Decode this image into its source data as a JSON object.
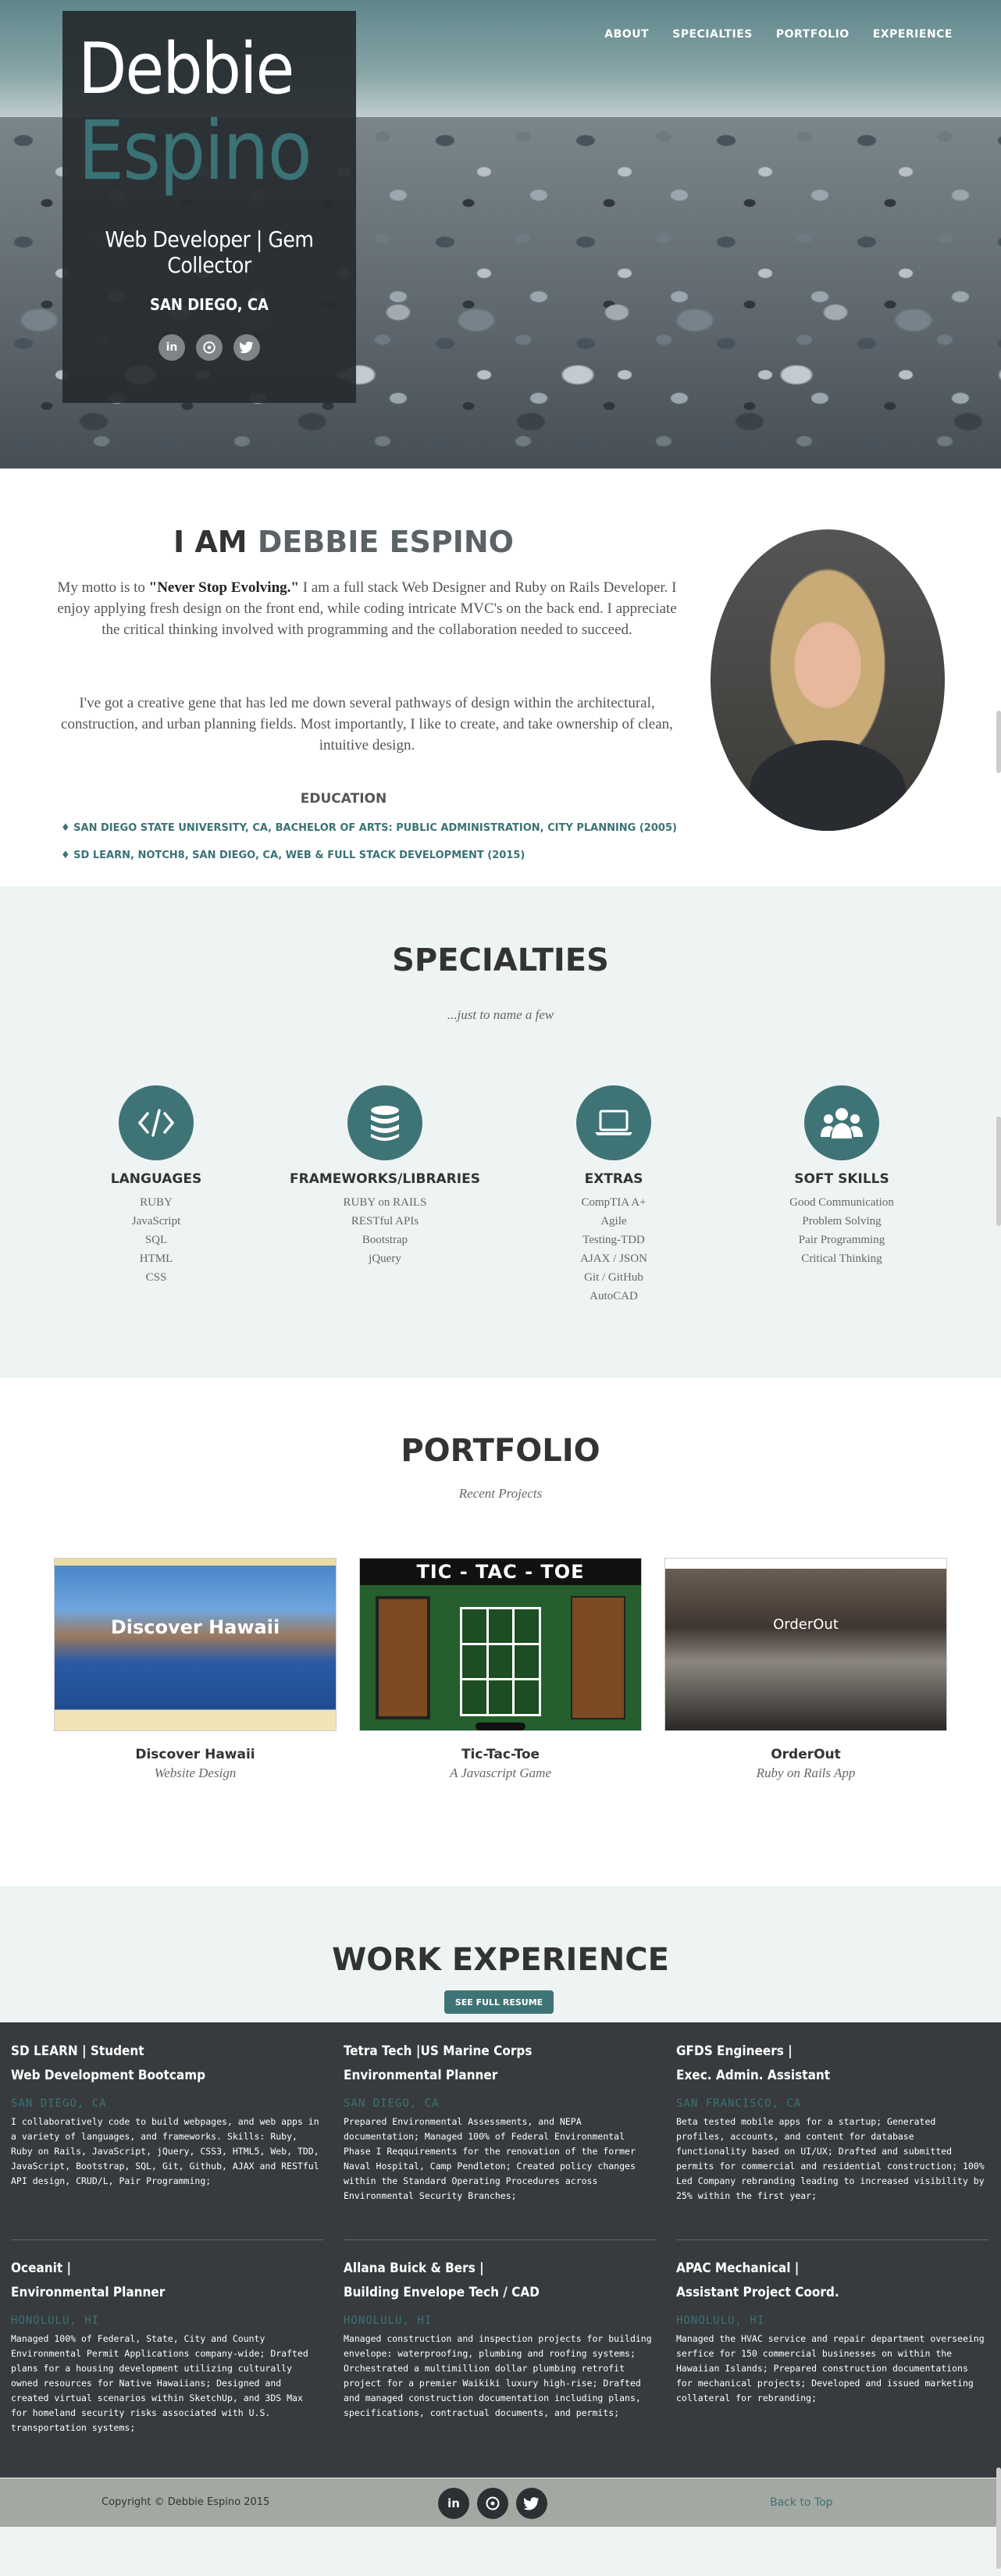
{
  "nav": {
    "items": [
      "ABOUT",
      "SPECIALTIES",
      "PORTFOLIO",
      "EXPERIENCE"
    ]
  },
  "hero": {
    "first_name": "Debbie",
    "last_name": "Espino",
    "tagline": "Web Developer | Gem Collector",
    "location": "SAN DIEGO, CA",
    "social": [
      "in",
      "gh",
      "tw"
    ]
  },
  "about": {
    "heading_prefix": "I AM ",
    "heading_name": "DEBBIE ESPINO",
    "p1_before": "My motto is to ",
    "p1_bold": "\"Never Stop Evolving.\"",
    "p1_after": " I am a full stack Web Designer and Ruby on Rails Developer. I enjoy applying fresh design on the front end, while coding intricate MVC's on the back end. I appreciate the critical thinking involved with programming and the collaboration needed to succeed.",
    "p2": "I've got a creative gene that has led me down several pathways of design within the architectural, construction, and urban planning fields. Most importantly, I like to create, and take ownership of clean, intuitive design.",
    "education_title": "EDUCATION",
    "education": [
      "♦ SAN DIEGO STATE UNIVERSITY, CA, BACHELOR OF ARTS: PUBLIC ADMINISTRATION, CITY PLANNING (2005)",
      "♦ SD LEARN, NOTCH8, SAN DIEGO, CA, WEB & FULL STACK DEVELOPMENT (2015)"
    ]
  },
  "specialties": {
    "title": "SPECIALTIES",
    "subtitle": "...just to name a few",
    "columns": [
      {
        "icon": "code-icon",
        "title": "LANGUAGES",
        "items": [
          "RUBY",
          "JavaScript",
          "SQL",
          "HTML",
          "CSS"
        ]
      },
      {
        "icon": "database-icon",
        "title": "FRAMEWORKS/LIBRARIES",
        "items": [
          "RUBY on RAILS",
          "RESTful APIs",
          "Bootstrap",
          "jQuery"
        ]
      },
      {
        "icon": "laptop-icon",
        "title": "EXTRAS",
        "items": [
          "CompTIA A+",
          "Agile",
          "Testing-TDD",
          "AJAX / JSON",
          "Git / GitHub",
          "AutoCAD"
        ]
      },
      {
        "icon": "users-icon",
        "title": "SOFT SKILLS",
        "items": [
          "Good Communication",
          "Problem Solving",
          "Pair Programming",
          "Critical Thinking"
        ]
      }
    ]
  },
  "portfolio": {
    "title": "PORTFOLIO",
    "subtitle": "Recent Projects",
    "projects": [
      {
        "name": "Discover Hawaii",
        "caption": "Website Design",
        "thumb_text": "Discover Hawaii"
      },
      {
        "name": "Tic-Tac-Toe",
        "caption": "A Javascript Game",
        "thumb_text": "TIC - TAC - TOE"
      },
      {
        "name": "OrderOut",
        "caption": "Ruby on Rails App",
        "thumb_text": "OrderOut"
      }
    ]
  },
  "experience": {
    "title": "WORK EXPERIENCE",
    "resume_button": "SEE FULL RESUME",
    "jobs": [
      {
        "company": "SD LEARN | Student",
        "role": "Web Development Bootcamp",
        "location": "SAN DIEGO, CA",
        "desc": "I collaboratively code to build webpages, and web apps in a variety of languages, and frameworks. Skills: Ruby, Ruby on Rails, JavaScript, jQuery, CSS3, HTML5, Web, TDD, JavaScript, Bootstrap, SQL, Git, Github, AJAX and RESTful API design, CRUD/L, Pair Programming;"
      },
      {
        "company": "Tetra Tech |US Marine Corps",
        "role": "Environmental Planner",
        "location": "SAN DIEGO, CA",
        "desc": "Prepared Environmental Assessments, and NEPA documentation; Managed 100% of Federal Environmental Phase I Reqquirements for the renovation of the former Naval Hospital, Camp Pendleton; Created policy changes within the Standard Operating Procedures across Environmental Security Branches;"
      },
      {
        "company": "GFDS Engineers |",
        "role": "Exec. Admin. Assistant",
        "location": "SAN FRANCISCO, CA",
        "desc": "Beta tested mobile apps for a startup; Generated profiles, accounts, and content for database functionality based on UI/UX; Drafted and submitted permits for commercial and residential construction; 100% Led Company rebranding leading to increased visibility by 25% within the first year;"
      },
      {
        "company": "Oceanit |",
        "role": "Environmental Planner",
        "location": "HONOLULU, HI",
        "desc": "Managed 100% of Federal, State, City and County Environmental Permit Applications company-wide; Drafted plans for a housing development utilizing culturally owned resources for Native Hawaiians; Designed and created virtual scenarios within SketchUp, and 3DS Max for homeland security risks associated with U.S. transportation systems;"
      },
      {
        "company": "Allana Buick & Bers |",
        "role": "Building Envelope Tech / CAD",
        "location": "HONOLULU, HI",
        "desc": "Managed construction and inspection projects for building envelope: waterproofing, plumbing and roofing systems; Orchestrated a multimillion dollar plumbing retrofit project for a premier Waikiki luxury high-rise; Drafted and managed construction documentation including plans, specifications, contractual documents, and permits;"
      },
      {
        "company": "APAC Mechanical |",
        "role": "Assistant Project Coord.",
        "location": "HONOLULU, HI",
        "desc": "Managed the HVAC service and repair department overseeing serfice for 150 commercial businesses on within the Hawaiian Islands; Prepared construction documentations for mechanical projects; Developed and issued marketing collateral for rebranding;"
      }
    ]
  },
  "footer": {
    "copyright": "Copyright © Debbie Espino 2015",
    "back_to_top": "Back to Top",
    "social": [
      "in",
      "gh",
      "tw"
    ]
  },
  "colors": {
    "accent": "#3f7477",
    "dark": "#373b3e"
  }
}
